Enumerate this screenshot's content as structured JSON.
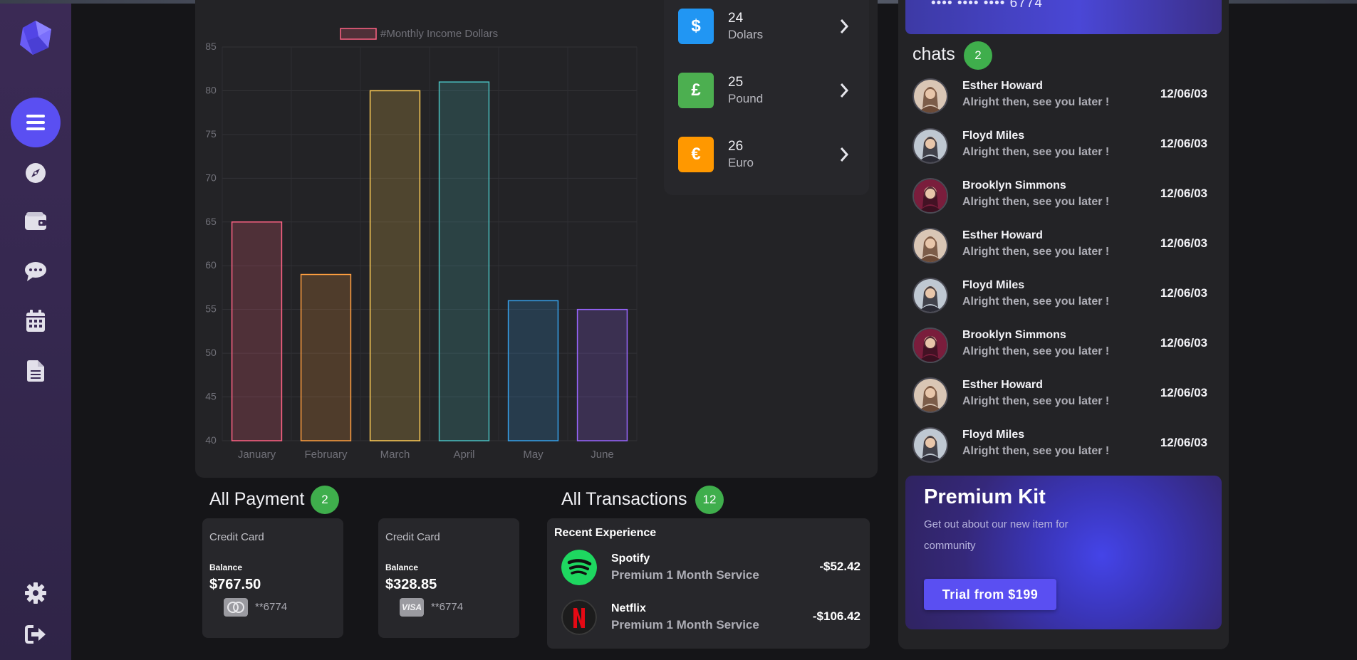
{
  "sidebar": {
    "icons": [
      "logo-icon",
      "menu-icon",
      "compass-icon",
      "wallet-icon",
      "chat-icon",
      "calendar-icon",
      "document-icon",
      "gear-icon",
      "logout-icon"
    ],
    "accent": "#5a4ff2"
  },
  "chart_data": {
    "type": "bar",
    "categories": [
      "January",
      "February",
      "March",
      "April",
      "May",
      "June"
    ],
    "series": [
      {
        "name": "#Monthly Income Dollars",
        "values": [
          65,
          59,
          80,
          81,
          56,
          55
        ]
      }
    ],
    "colors": [
      "#ff6384",
      "#ff9f40",
      "#ffcd56",
      "#4bc0c0",
      "#36a2eb",
      "#9966ff"
    ],
    "ylim": [
      40,
      85
    ],
    "yticks": [
      40,
      45,
      50,
      55,
      60,
      65,
      70,
      75,
      80,
      85
    ],
    "legend": "top-center",
    "grid": true
  },
  "currencies": [
    {
      "symbol": "$",
      "number": "24",
      "name": "Dolars",
      "color": "#2196f3"
    },
    {
      "symbol": "£",
      "number": "25",
      "name": "Pound",
      "color": "#4caf50"
    },
    {
      "symbol": "€",
      "number": "26",
      "name": "Euro",
      "color": "#ff9800"
    }
  ],
  "top_card": {
    "number": "6774"
  },
  "chats": {
    "title": "chats",
    "count": "2",
    "items": [
      {
        "name": "Esther Howard",
        "message": "Alright then, see you later !",
        "date": "12/06/03"
      },
      {
        "name": "Floyd Miles",
        "message": "Alright then, see you later !",
        "date": "12/06/03"
      },
      {
        "name": "Brooklyn Simmons",
        "message": "Alright then, see you later !",
        "date": "12/06/03"
      },
      {
        "name": "Esther Howard",
        "message": "Alright then, see you later !",
        "date": "12/06/03"
      },
      {
        "name": "Floyd Miles",
        "message": "Alright then, see you later !",
        "date": "12/06/03"
      },
      {
        "name": "Brooklyn Simmons",
        "message": "Alright then, see you later !",
        "date": "12/06/03"
      },
      {
        "name": "Esther Howard",
        "message": "Alright then, see you later !",
        "date": "12/06/03"
      },
      {
        "name": "Floyd Miles",
        "message": "Alright then, see you later !",
        "date": "12/06/03"
      }
    ]
  },
  "premium": {
    "title": "Premium Kit",
    "description": "Get out about our new item for community",
    "button": "Trial from $199"
  },
  "payments": {
    "title": "All Payment",
    "count": "2",
    "cards": [
      {
        "type": "Credit Card",
        "balance_label": "Balance",
        "balance": "$767.50",
        "brand": "mastercard-icon",
        "number": "**6774"
      },
      {
        "type": "Credit Card",
        "balance_label": "Balance",
        "balance": "$328.85",
        "brand": "visa-icon",
        "brand_text": "VISA",
        "number": "**6774"
      }
    ]
  },
  "transactions": {
    "title": "All Transactions",
    "count": "12",
    "heading": "Recent Experience",
    "items": [
      {
        "name": "Spotify",
        "description": "Premium 1 Month Service",
        "amount": "-$52.42"
      },
      {
        "name": "Netflix",
        "description": "Premium 1 Month Service",
        "amount": "-$106.42"
      }
    ]
  }
}
